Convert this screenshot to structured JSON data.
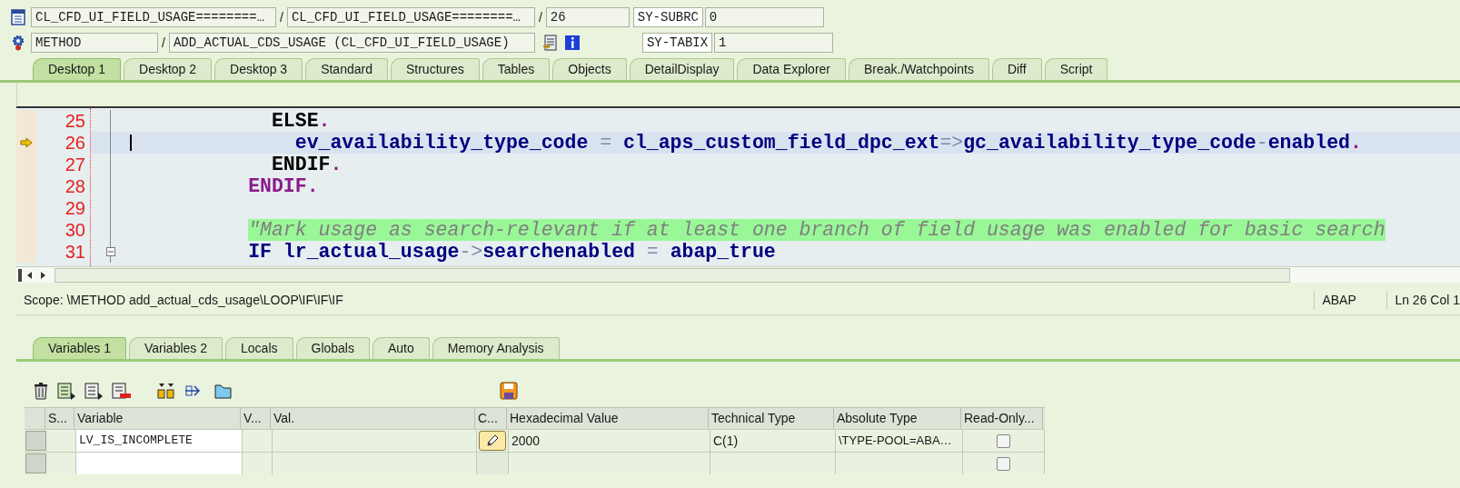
{
  "header": {
    "program": "CL_CFD_UI_FIELD_USAGE========…",
    "include": "CL_CFD_UI_FIELD_USAGE========…",
    "line": "26",
    "event_type": "METHOD",
    "event": "ADD_ACTUAL_CDS_USAGE (CL_CFD_UI_FIELD_USAGE)",
    "separators": [
      "/",
      "/",
      "/"
    ],
    "system_fields": [
      {
        "name": "SY-SUBRC",
        "value": "0"
      },
      {
        "name": "SY-TABIX",
        "value": "1"
      }
    ]
  },
  "desktop_tabs": [
    {
      "label": "Desktop 1",
      "selected": true
    },
    {
      "label": "Desktop 2",
      "selected": false
    },
    {
      "label": "Desktop 3",
      "selected": false
    },
    {
      "label": "Standard",
      "selected": false
    },
    {
      "label": "Structures",
      "selected": false
    },
    {
      "label": "Tables",
      "selected": false
    },
    {
      "label": "Objects",
      "selected": false
    },
    {
      "label": "DetailDisplay",
      "selected": false
    },
    {
      "label": "Data Explorer",
      "selected": false
    },
    {
      "label": "Break./Watchpoints",
      "selected": false
    },
    {
      "label": "Diff",
      "selected": false
    },
    {
      "label": "Script",
      "selected": false
    }
  ],
  "editor": {
    "lines": [
      {
        "number": "25",
        "current": false,
        "collapsible": false,
        "tokens": [
          {
            "text": "           ELSE",
            "kind": "keyword"
          },
          {
            "text": ".",
            "kind": "period"
          }
        ]
      },
      {
        "number": "26",
        "current": true,
        "collapsible": false,
        "tokens": [
          {
            "text": "             ev_availability_type_code",
            "kind": "ident"
          },
          {
            "text": " = ",
            "kind": "operator"
          },
          {
            "text": "cl_aps_custom_field_dpc_ext",
            "kind": "ident"
          },
          {
            "text": "=>",
            "kind": "operator"
          },
          {
            "text": "gc_availability_type_code",
            "kind": "ident"
          },
          {
            "text": "-",
            "kind": "operator"
          },
          {
            "text": "enabled",
            "kind": "ident"
          },
          {
            "text": ".",
            "kind": "period"
          }
        ]
      },
      {
        "number": "27",
        "current": false,
        "collapsible": false,
        "tokens": [
          {
            "text": "           ENDIF",
            "kind": "keyword"
          },
          {
            "text": ".",
            "kind": "period"
          }
        ]
      },
      {
        "number": "28",
        "current": false,
        "collapsible": false,
        "tokens": [
          {
            "text": "         ENDIF",
            "kind": "block_keyword"
          },
          {
            "text": ".",
            "kind": "period"
          }
        ]
      },
      {
        "number": "29",
        "current": false,
        "collapsible": false
      },
      {
        "number": "30",
        "current": false,
        "collapsible": false,
        "tokens": [
          {
            "text": "         \"Mark usage as search-relevant if at least one branch of field usage was enabled for basic search",
            "kind": "comment"
          }
        ]
      },
      {
        "number": "31",
        "current": false,
        "collapsible": true,
        "tokens": [
          {
            "text": "         IF",
            "kind": "ident"
          },
          {
            "text": " lr_actual_usage",
            "kind": "ident"
          },
          {
            "text": "->",
            "kind": "operator"
          },
          {
            "text": "searchenabled",
            "kind": "ident"
          },
          {
            "text": " = ",
            "kind": "operator"
          },
          {
            "text": "abap_true",
            "kind": "ident"
          }
        ]
      }
    ]
  },
  "status_bar": {
    "scope": "Scope: \\METHOD add_actual_cds_usage\\LOOP\\IF\\IF\\IF",
    "language": "ABAP",
    "position": "Ln 26 Col 1"
  },
  "variable_tabs": [
    {
      "label": "Variables 1",
      "selected": true
    },
    {
      "label": "Variables 2",
      "selected": false
    },
    {
      "label": "Locals",
      "selected": false
    },
    {
      "label": "Globals",
      "selected": false
    },
    {
      "label": "Auto",
      "selected": false
    },
    {
      "label": "Memory Analysis",
      "selected": false
    }
  ],
  "table": {
    "columns": [
      "S...",
      "Variable",
      "V...",
      "Val.",
      "C...",
      "Hexadecimal Value",
      "Technical Type",
      "Absolute Type",
      "Read-Only..."
    ],
    "rows": [
      {
        "variable": "LV_IS_INCOMPLETE",
        "change_button": true,
        "hexadecimal_value": "2000",
        "technical_type": "C(1)",
        "absolute_type": "\\TYPE-POOL=ABA…",
        "read_only": false
      },
      {
        "change_button": false,
        "read_only": false
      }
    ]
  }
}
